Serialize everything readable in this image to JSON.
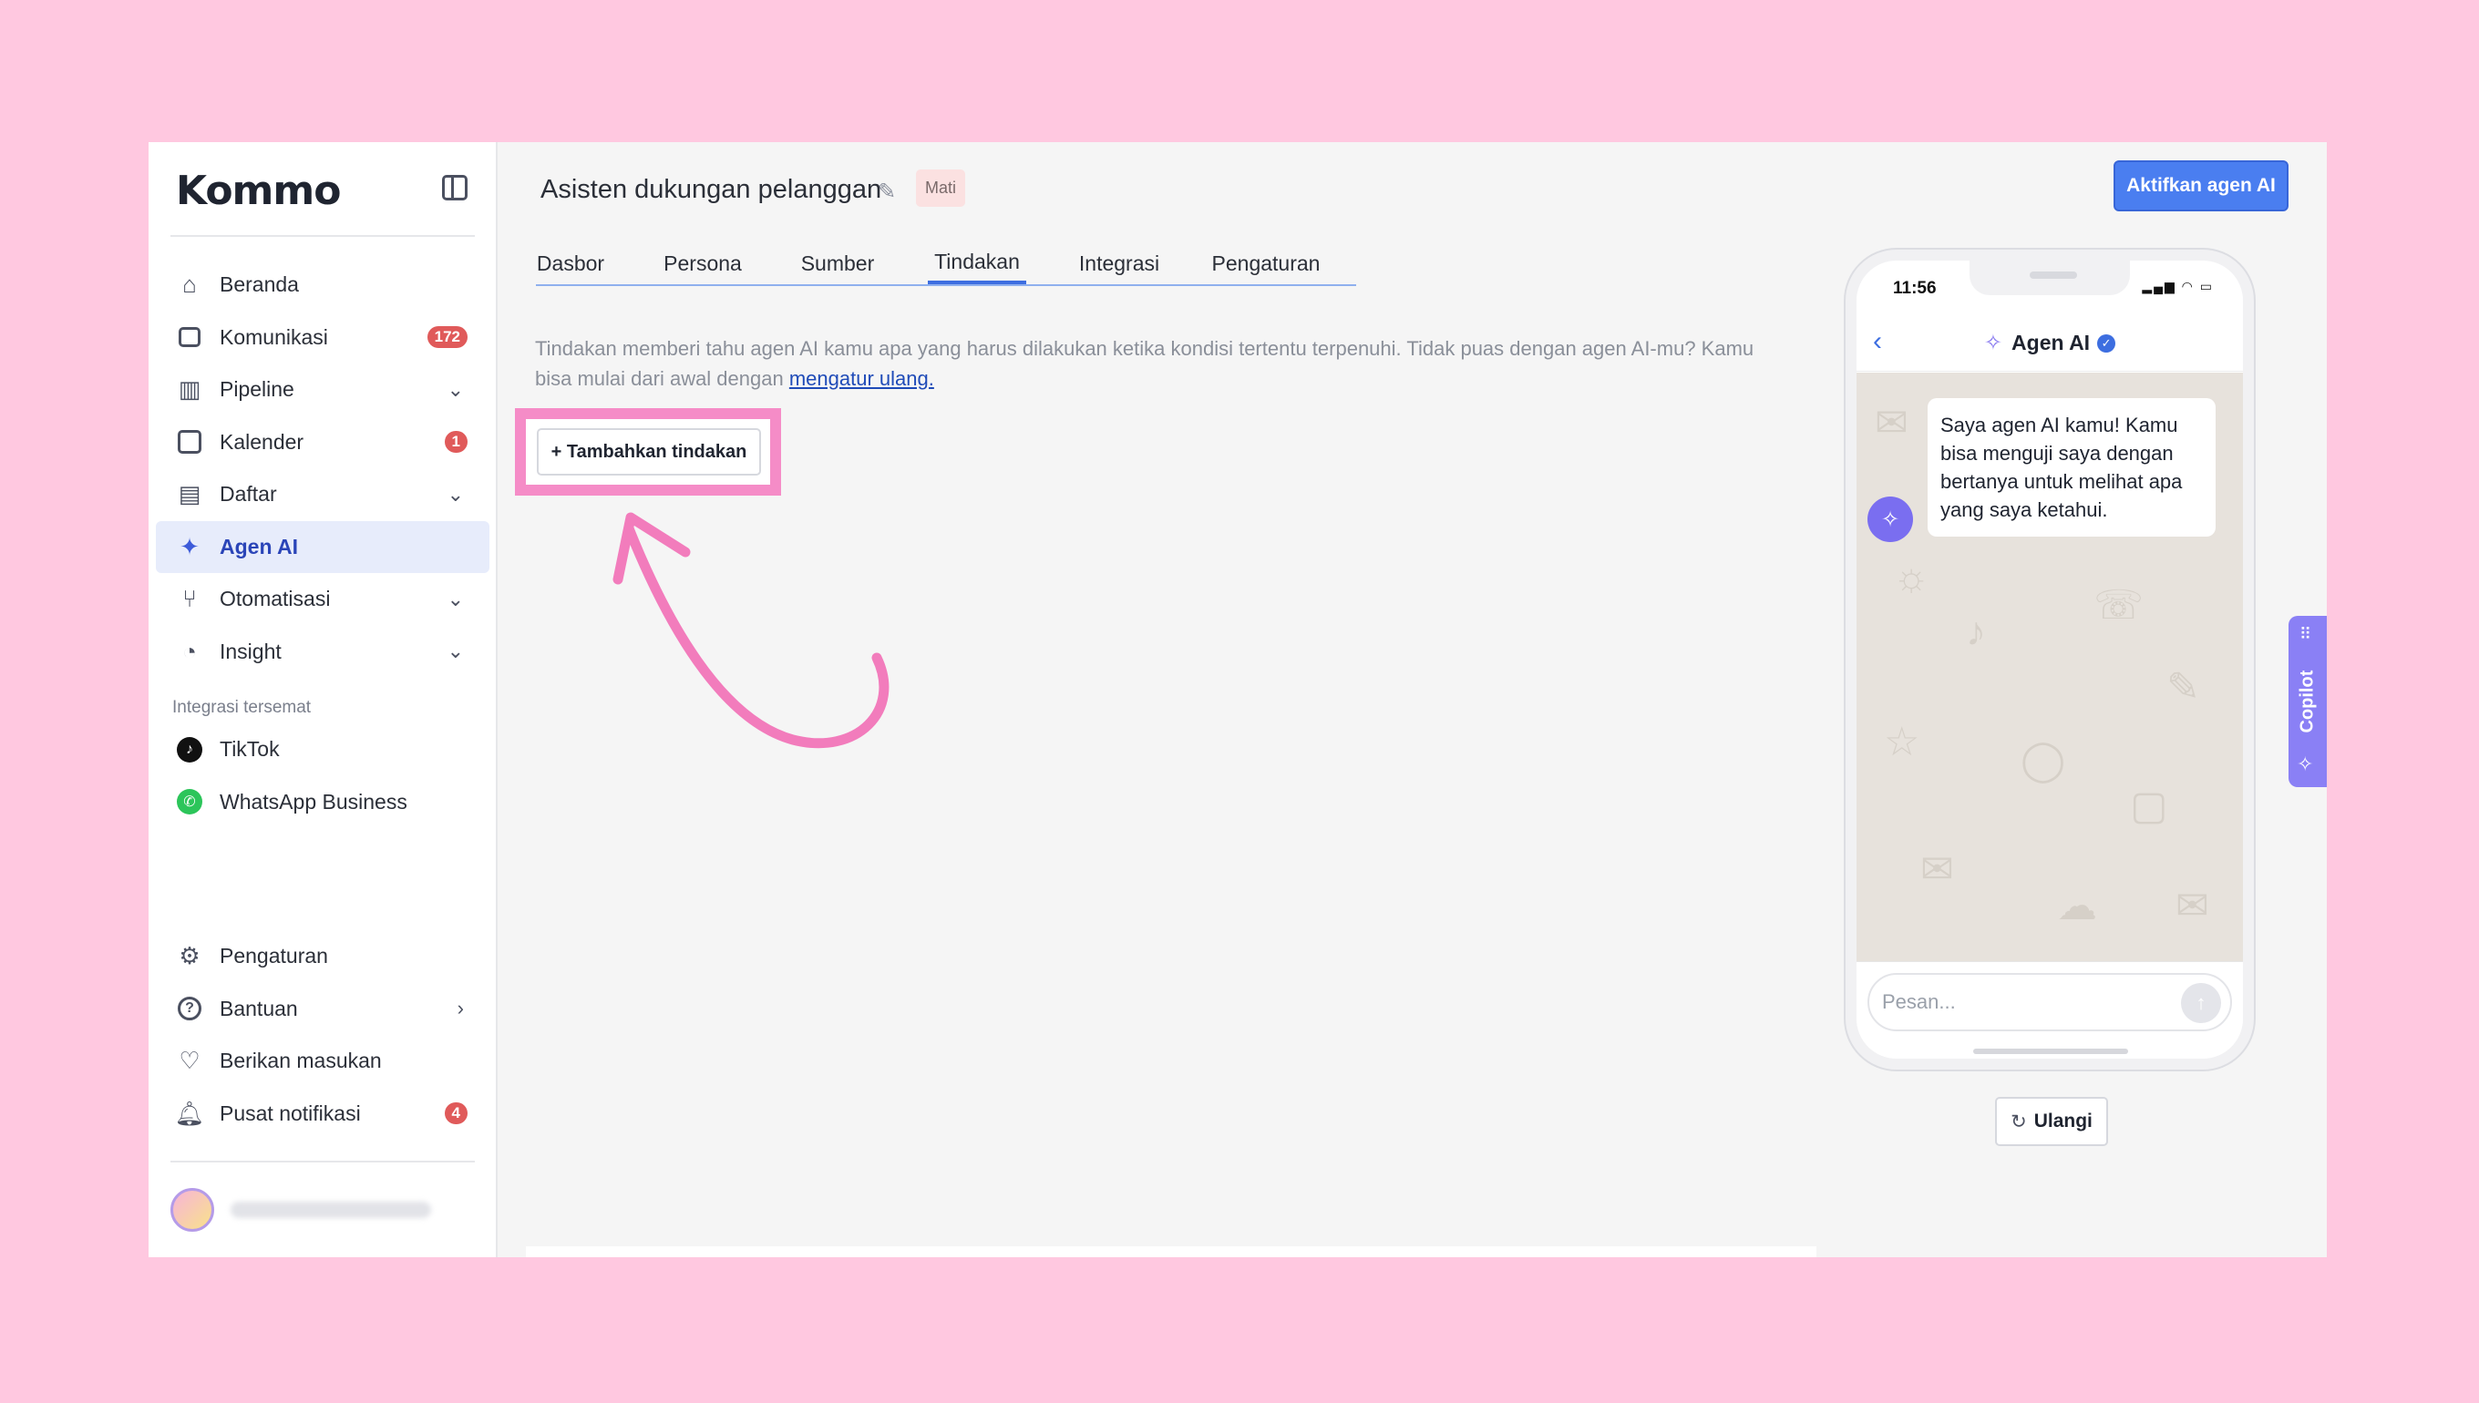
{
  "brand": {
    "logo_text": "Kommo"
  },
  "sidebar": {
    "items": [
      {
        "label": "Beranda",
        "icon": "home-icon"
      },
      {
        "label": "Komunikasi",
        "icon": "chat-icon",
        "badge": "172"
      },
      {
        "label": "Pipeline",
        "icon": "pipeline-icon"
      },
      {
        "label": "Kalender",
        "icon": "calendar-icon",
        "badge": "1"
      },
      {
        "label": "Daftar",
        "icon": "list-icon"
      },
      {
        "label": "Agen AI",
        "icon": "sparkle-icon"
      },
      {
        "label": "Otomatisasi",
        "icon": "automation-icon"
      },
      {
        "label": "Insight",
        "icon": "chart-icon"
      }
    ],
    "section_label": "Integrasi tersemat",
    "integrations": [
      {
        "label": "TikTok",
        "icon": "tiktok-icon"
      },
      {
        "label": "WhatsApp Business",
        "icon": "whatsapp-icon"
      }
    ],
    "bottom_items": [
      {
        "label": "Pengaturan",
        "icon": "gear-icon"
      },
      {
        "label": "Bantuan",
        "icon": "help-icon"
      },
      {
        "label": "Berikan masukan",
        "icon": "heart-icon"
      },
      {
        "label": "Pusat notifikasi",
        "icon": "bell-icon",
        "badge": "4"
      }
    ]
  },
  "header": {
    "title": "Asisten dukungan pelanggan",
    "status": "Mati",
    "activate_label": "Aktifkan agen AI"
  },
  "tabs": [
    "Dasbor",
    "Persona",
    "Sumber",
    "Tindakan",
    "Integrasi",
    "Pengaturan"
  ],
  "active_tab": "Tindakan",
  "content": {
    "description": "Tindakan memberi tahu agen AI kamu apa yang harus dilakukan ketika kondisi tertentu terpenuhi. Tidak puas dengan agen AI-mu? Kamu bisa mulai dari awal dengan",
    "reset_link": "mengatur ulang.",
    "add_action_label": "+ Tambahkan tindakan"
  },
  "phone": {
    "time": "11:56",
    "chat_title": "Agen AI",
    "bot_message": "Saya agen AI kamu! Kamu bisa menguji saya dengan bertanya untuk melihat apa yang saya ketahui.",
    "input_placeholder": "Pesan...",
    "reset_label": "Ulangi"
  },
  "copilot": {
    "label": "Copilot"
  },
  "colors": {
    "background": "#ffc8e0",
    "accent": "#4a7ef0",
    "highlight": "#f58cc7",
    "badge": "#e05a5a",
    "copilot": "#8a80f5"
  }
}
